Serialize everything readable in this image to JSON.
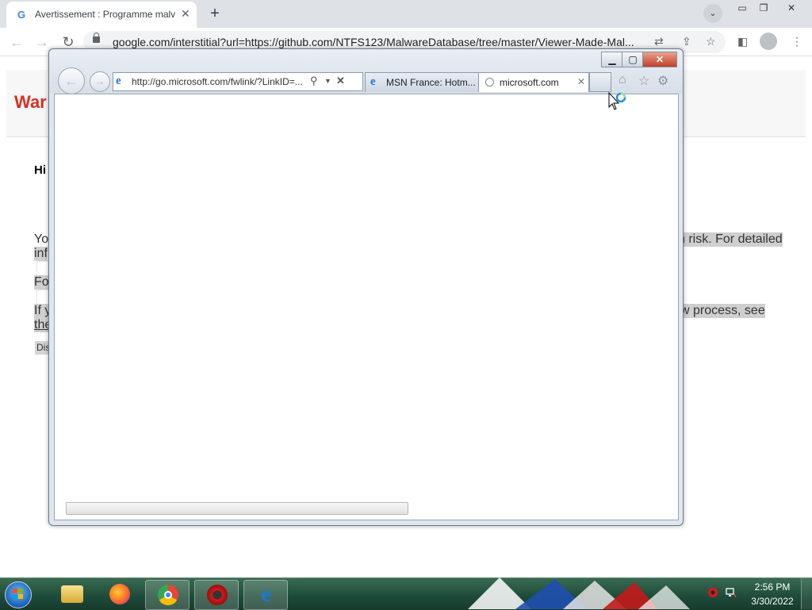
{
  "chrome": {
    "tab_title": "Avertissement : Programme malv",
    "tab_favicon": "G",
    "url": "google.com/interstitial?url=https://github.com/NTFS123/MalwareDatabase/tree/master/Viewer-Made-Mal..."
  },
  "warning_page": {
    "title_partial": "War",
    "heading_partial": "Hi",
    "para1_left": "Yo",
    "para1_right": "n risk. For detailed",
    "para1_line2": "inf",
    "para2_left": "Fo",
    "para3_left": "If y",
    "para3_right": "w process, see",
    "para3_line2": "the",
    "dismiss_partial": "Dis"
  },
  "ie": {
    "address": "http://go.microsoft.com/fwlink/?LinkID=...",
    "tabs": [
      {
        "title": "MSN France: Hotm..."
      },
      {
        "title": "microsoft.com"
      }
    ]
  },
  "taskbar": {
    "time": "2:56 PM",
    "date": "3/30/2022",
    "apps": [
      "file-explorer",
      "firefox",
      "chrome",
      "antivirus",
      "internet-explorer"
    ]
  },
  "colors": {
    "warning_red": "#d93025",
    "ie_blue": "#1a78d6",
    "taskbar_green": "#1d4a38"
  }
}
